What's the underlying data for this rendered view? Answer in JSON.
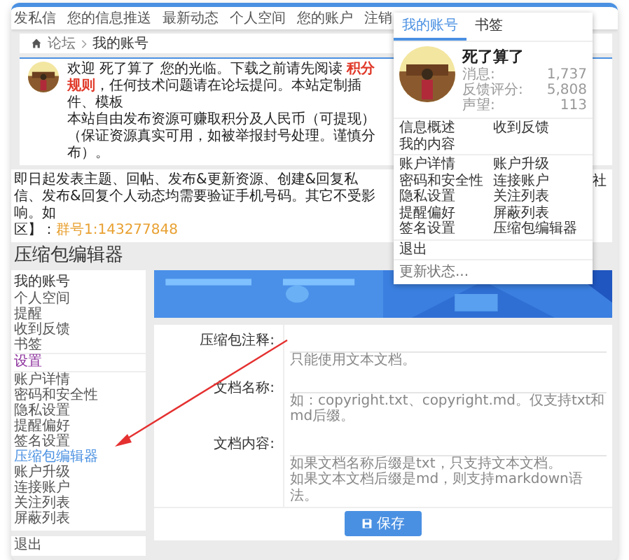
{
  "nav_links": [
    "发私信",
    "您的信息推送",
    "最新动态",
    "个人空间",
    "您的账户",
    "注销"
  ],
  "account_menu": {
    "tabs": [
      {
        "label": "我的账号",
        "selected": true
      },
      {
        "label": "书签",
        "selected": false
      }
    ],
    "username": "死了算了",
    "stats": [
      {
        "label": "消息:",
        "value": "1,737"
      },
      {
        "label": "反馈评分:",
        "value": "5,808"
      },
      {
        "label": "声望:",
        "value": "113"
      }
    ],
    "groups": [
      [
        "信息概述",
        "收到反馈",
        "我的内容"
      ],
      [
        "账户详情",
        "账户升级",
        "密码和安全性",
        "连接账户",
        "隐私设置",
        "关注列表",
        "提醒偏好",
        "屏蔽列表",
        "签名设置",
        "压缩包编辑器"
      ],
      [
        "退出"
      ]
    ],
    "status_placeholder": "更新状态..."
  },
  "breadcrumb": [
    "论坛",
    "我的账号"
  ],
  "notice": {
    "text": "欢迎 死了算了 您的光临。下载之前请先阅读 **积分规则**，任何技术问题请在论坛提问。本站定制插件、模板",
    "text_2": "本站自由发布资源可赚取积分及人民币（可提现）（保证资源真实可用，如被举报封号处理。谨慎分布）。"
  },
  "notice_2": {
    "text": "即日起发表主题、回帖、发布&更新资源、创建&回复私信、发布&回复个人动态均需要验证手机号码。其它不受影响。如",
    "text_2": "社",
    "text_3": "区】：",
    "group_link": "群号1:143277848"
  },
  "heading": "压缩包编辑器",
  "sidebar": {
    "items": [
      {
        "label": "我的账号",
        "kind": "header",
        "selected": false
      },
      {
        "label": "个人空间",
        "kind": "link",
        "selected": false
      },
      {
        "label": "提醒",
        "kind": "link",
        "selected": false
      },
      {
        "label": "收到反馈",
        "kind": "link",
        "selected": false
      },
      {
        "label": "书签",
        "kind": "link",
        "selected": false
      },
      {
        "label": "设置",
        "kind": "section",
        "selected": false
      },
      {
        "label": "账户详情",
        "kind": "link",
        "selected": false
      },
      {
        "label": "密码和安全性",
        "kind": "link",
        "selected": false
      },
      {
        "label": "隐私设置",
        "kind": "link",
        "selected": false
      },
      {
        "label": "提醒偏好",
        "kind": "link",
        "selected": false
      },
      {
        "label": "签名设置",
        "kind": "link",
        "selected": false
      },
      {
        "label": "压缩包编辑器",
        "kind": "link",
        "selected": true
      },
      {
        "label": "账户升级",
        "kind": "link",
        "selected": false
      },
      {
        "label": "连接账户",
        "kind": "link",
        "selected": false
      },
      {
        "label": "关注列表",
        "kind": "link",
        "selected": false
      },
      {
        "label": "屏蔽列表",
        "kind": "link",
        "selected": false
      }
    ],
    "logout": "退出"
  },
  "banner": {
    "kind": "picture"
  },
  "form": {
    "fields": [
      {
        "label": "压缩包注释:",
        "kind": "textarea",
        "hints": [
          "只能使用文本文档。"
        ]
      },
      {
        "label": "文档名称:",
        "kind": "input",
        "hints": [
          "如：copyright.txt、copyright.md。仅支持txt和md后缀。"
        ]
      },
      {
        "label": "文档内容:",
        "kind": "textarea",
        "hints": [
          "如果文档名称后缀是txt，只支持文本文档。",
          "如果文本文档后缀是md，则支持markdown语法。"
        ]
      }
    ],
    "submit": "保存"
  }
}
